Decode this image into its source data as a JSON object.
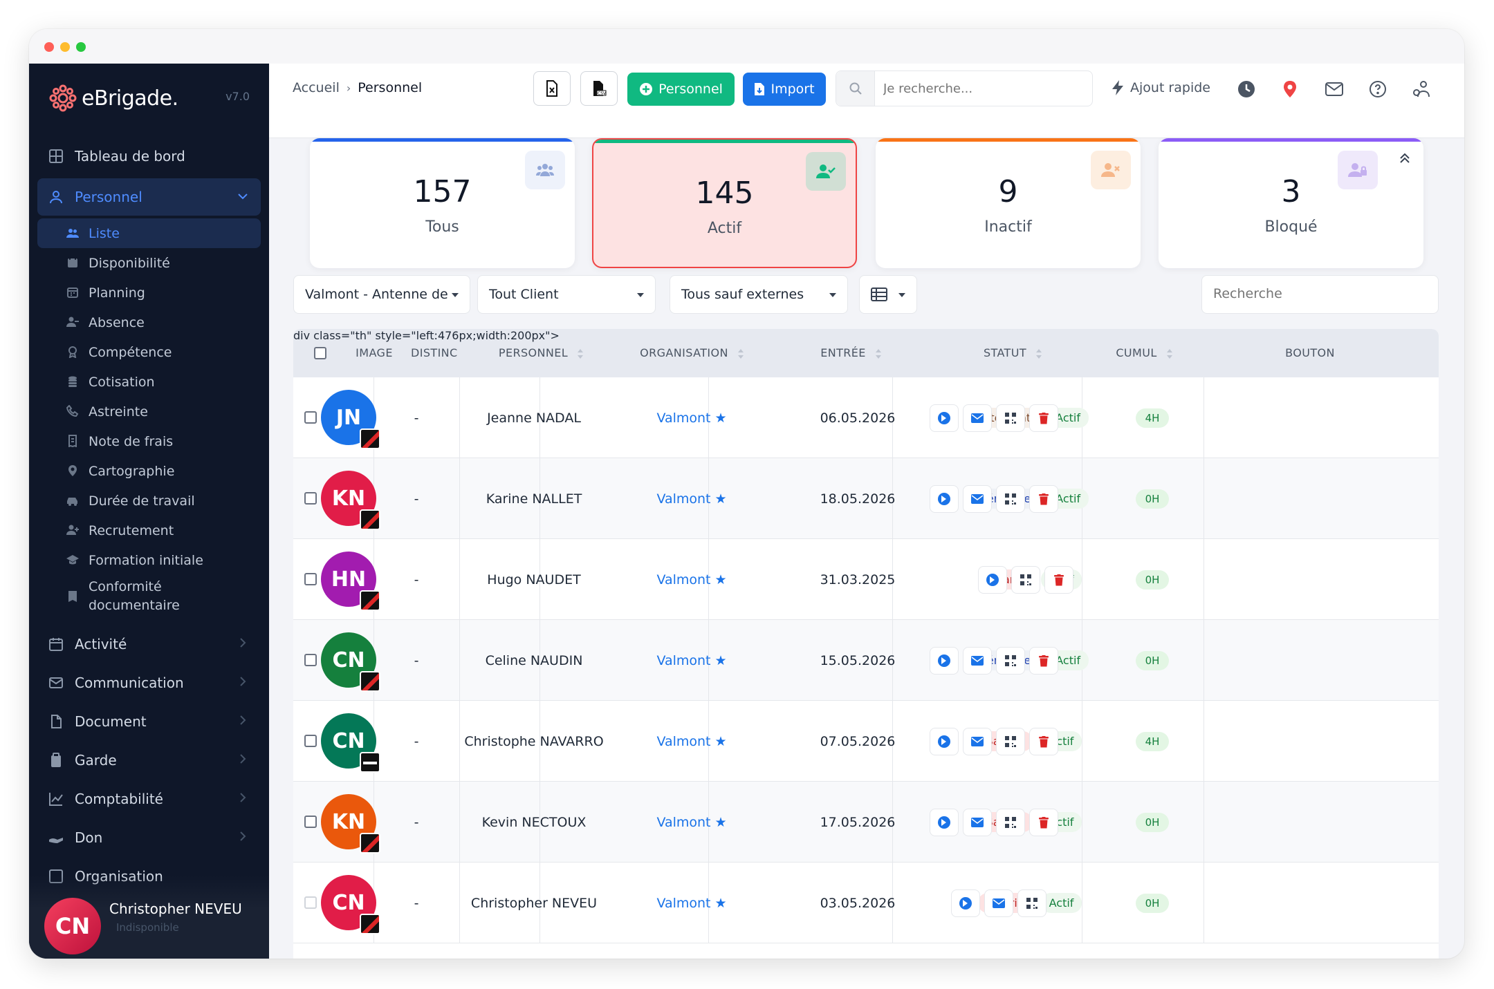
{
  "sidebar": {
    "brand": "eBrigade.",
    "version": "v7.0",
    "items_top": [
      {
        "label": "Tableau de bord",
        "icon": "dashboard-icon"
      },
      {
        "label": "Personnel",
        "icon": "user-icon"
      }
    ],
    "sub_items": [
      {
        "label": "Liste",
        "icon": "users-icon"
      },
      {
        "label": "Disponibilité",
        "icon": "calendar-check-icon"
      },
      {
        "label": "Planning",
        "icon": "calendar-icon"
      },
      {
        "label": "Absence",
        "icon": "user-minus-icon"
      },
      {
        "label": "Compétence",
        "icon": "award-icon"
      },
      {
        "label": "Cotisation",
        "icon": "coins-icon"
      },
      {
        "label": "Astreinte",
        "icon": "phone-icon"
      },
      {
        "label": "Note de frais",
        "icon": "receipt-icon"
      },
      {
        "label": "Cartographie",
        "icon": "map-pin-icon"
      },
      {
        "label": "Durée de travail",
        "icon": "car-icon"
      },
      {
        "label": "Recrutement",
        "icon": "user-plus-icon"
      },
      {
        "label": "Formation initiale",
        "icon": "graduation-icon"
      },
      {
        "label": "Conformité\ndocumentaire",
        "icon": "badge-icon"
      }
    ],
    "items_bottom": [
      {
        "label": "Activité",
        "icon": "calendar-icon"
      },
      {
        "label": "Communication",
        "icon": "mail-icon"
      },
      {
        "label": "Document",
        "icon": "file-icon"
      },
      {
        "label": "Garde",
        "icon": "clipboard-icon"
      },
      {
        "label": "Comptabilité",
        "icon": "chart-icon"
      },
      {
        "label": "Don",
        "icon": "hand-icon"
      },
      {
        "label": "Organisation",
        "icon": "org-icon"
      }
    ],
    "user": {
      "initials": "CN",
      "name": "Christopher NEVEU",
      "status": "Indisponible"
    }
  },
  "topbar": {
    "breadcrumb": [
      "Accueil",
      "Personnel"
    ],
    "btn_personnel": "Personnel",
    "btn_import": "Import",
    "search_placeholder": "Je recherche...",
    "quick_add": "Ajout rapide"
  },
  "stats": [
    {
      "value": "157",
      "label": "Tous",
      "color": "#2563eb"
    },
    {
      "value": "145",
      "label": "Actif",
      "color": "#10b981"
    },
    {
      "value": "9",
      "label": "Inactif",
      "color": "#f97316"
    },
    {
      "value": "3",
      "label": "Bloqué",
      "color": "#8b5cf6"
    }
  ],
  "filters": {
    "section": "Valmont - Antenne de",
    "client": "Tout Client",
    "type": "Tous sauf externes",
    "search_placeholder": "Recherche"
  },
  "table": {
    "headers": [
      "IMAGE",
      "DISTINC",
      "PERSONNEL",
      "ORGANISATION",
      "ENTRÉE",
      "STATUT",
      "CUMUL",
      "BOUTON"
    ],
    "rows": [
      {
        "initials": "JN",
        "color": "#1a73e8",
        "distinction": "-",
        "name": "Jeanne NADAL",
        "org": "Valmont",
        "date": "06.05.2026",
        "statut": "Alternant",
        "statut_kind": "alt",
        "etat": "Actif",
        "cumul": "4H"
      },
      {
        "initials": "KN",
        "color": "#e11d48",
        "distinction": "-",
        "name": "Karine NALLET",
        "org": "Valmont",
        "date": "18.05.2026",
        "statut": "Bénévole",
        "statut_kind": "ben",
        "etat": "Actif",
        "cumul": "0H"
      },
      {
        "initials": "HN",
        "color": "#a21caf",
        "distinction": "-",
        "name": "Hugo NAUDET",
        "org": "Valmont",
        "date": "31.03.2025",
        "statut": "Salarié",
        "statut_kind": "sal",
        "etat": "Actif",
        "cumul": "0H"
      },
      {
        "initials": "CN",
        "color": "#15803d",
        "distinction": "-",
        "name": "Celine NAUDIN",
        "org": "Valmont",
        "date": "15.05.2026",
        "statut": "Bénévole",
        "statut_kind": "ben",
        "etat": "Actif",
        "cumul": "0H"
      },
      {
        "initials": "CN",
        "color": "#047857",
        "distinction": "-",
        "name": "Christophe NAVARRO",
        "org": "Valmont",
        "date": "07.05.2026",
        "statut": "Salarié",
        "statut_kind": "sal",
        "etat": "Actif",
        "cumul": "4H"
      },
      {
        "initials": "KN",
        "color": "#ea580c",
        "distinction": "-",
        "name": "Kevin NECTOUX",
        "org": "Valmont",
        "date": "17.05.2026",
        "statut": "Salarié",
        "statut_kind": "sal",
        "etat": "Actif",
        "cumul": "0H"
      },
      {
        "initials": "CN",
        "color": "#e11d48",
        "distinction": "-",
        "name": "Christopher NEVEU",
        "org": "Valmont",
        "date": "03.05.2026",
        "statut": "Salarié",
        "statut_kind": "sal",
        "etat": "Actif",
        "cumul": "0H"
      }
    ]
  }
}
